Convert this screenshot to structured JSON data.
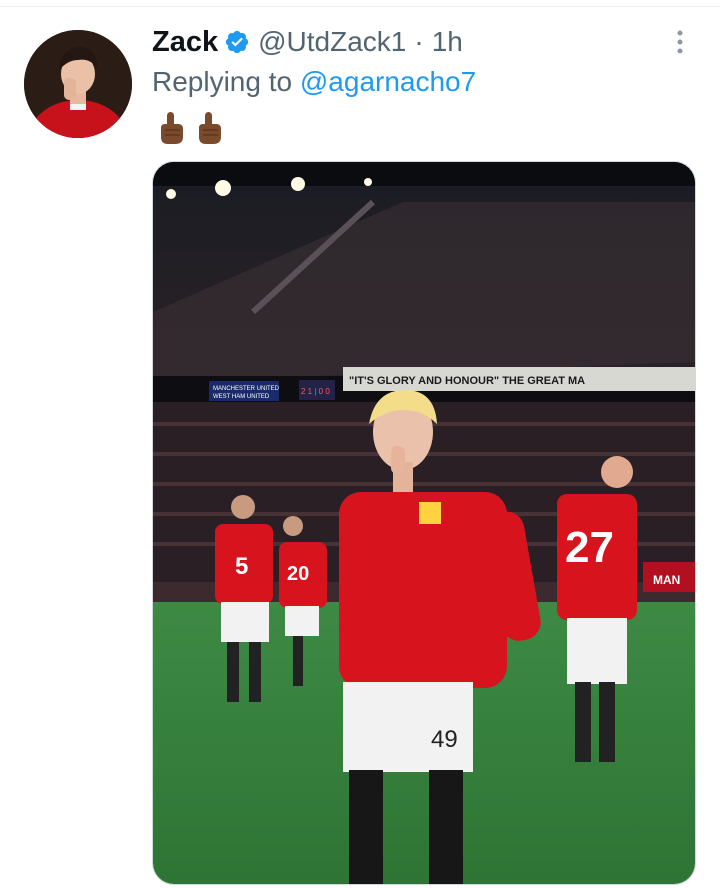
{
  "tweet": {
    "author": {
      "display_name": "Zack",
      "verified": true,
      "handle": "@UtdZack1",
      "avatar_icon": "profile-avatar"
    },
    "separator": "·",
    "time": "1h",
    "reply_prefix": "Replying to",
    "reply_to": "@agarnacho7",
    "text_emojis": [
      "point-up-icon",
      "point-up-icon"
    ],
    "more_icon": "more-vertical-icon"
  },
  "media": {
    "banner_text": "\"IT'S GLORY AND HONOUR\" THE GREAT MA",
    "scoreboard_left": "MANCHESTER UNITED",
    "scoreboard_left_2": "WEST HAM UNITED",
    "scoreboard_score": "2 1 | 0 0",
    "shirt_numbers": [
      "5",
      "20",
      "27",
      "49"
    ]
  },
  "colors": {
    "accent": "#1d9bf0",
    "muted": "#536471",
    "text": "#0f1419",
    "kit_red": "#d7131e"
  }
}
